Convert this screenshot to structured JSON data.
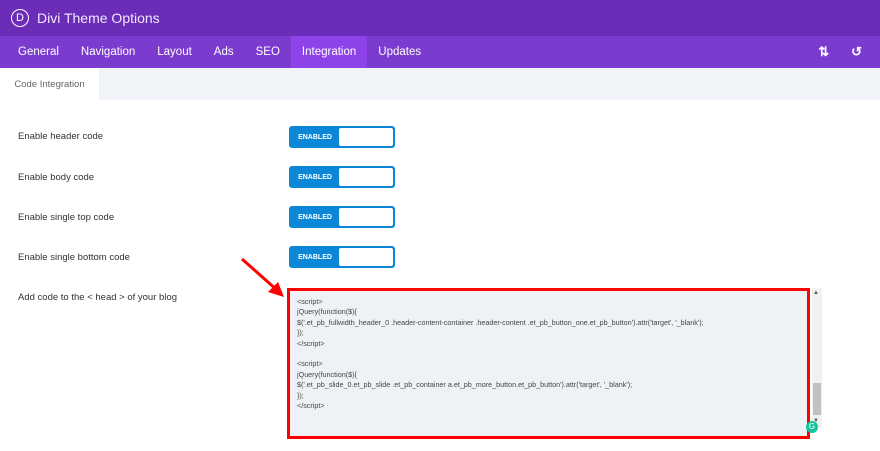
{
  "header": {
    "logo": "D",
    "title": "Divi Theme Options"
  },
  "nav": {
    "tabs": [
      "General",
      "Navigation",
      "Layout",
      "Ads",
      "SEO",
      "Integration",
      "Updates"
    ],
    "active": "Integration",
    "icons": [
      "sort-icon",
      "reset-icon"
    ],
    "icon_glyphs": [
      "⇅",
      "↺"
    ]
  },
  "subtab": {
    "label": "Code Integration"
  },
  "settings": [
    {
      "label": "Enable header code",
      "toggle": "ENABLED"
    },
    {
      "label": "Enable body code",
      "toggle": "ENABLED"
    },
    {
      "label": "Enable single top code",
      "toggle": "ENABLED"
    },
    {
      "label": "Enable single bottom code",
      "toggle": "ENABLED"
    }
  ],
  "head_code": {
    "label": "Add code to the < head > of your blog",
    "value": "<script>\njQuery(function($){\n$('.et_pb_fullwidth_header_0 .header-content-container .header-content .et_pb_button_one.et_pb_button').attr('target', '_blank');\n});\n</script>\n\n<script>\njQuery(function($){\n$('.et_pb_slide_0.et_pb_slide .et_pb_container a.et_pb_more_button.et_pb_button').attr('target', '_blank');\n});\n</script>"
  },
  "colors": {
    "header": "#6b2db8",
    "nav": "#7b3bcf",
    "active": "#8e43ea",
    "toggle": "#0c86d6",
    "highlight": "#ff0000"
  }
}
